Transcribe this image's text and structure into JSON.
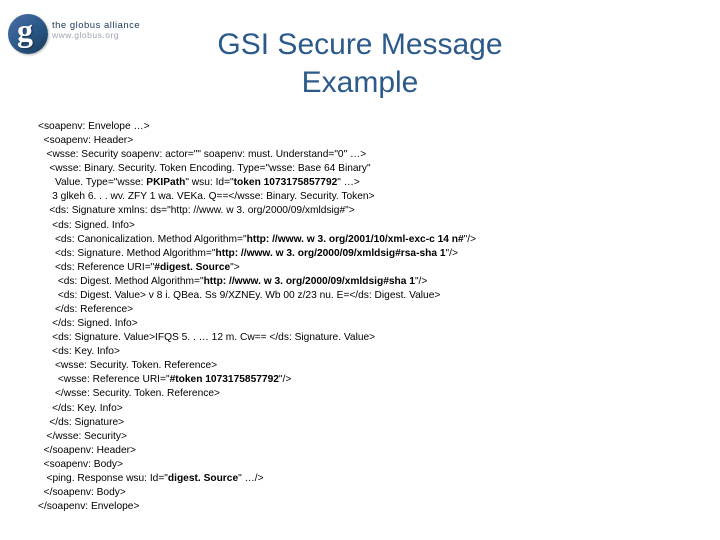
{
  "logo": {
    "main": "the globus alliance",
    "sub": "www.globus.org"
  },
  "title": "GSI Secure Message\nExample",
  "code": {
    "l01": "<soapenv: Envelope …>",
    "l02": "  <soapenv: Header>",
    "l03": "   <wsse: Security soapenv: actor=\"\" soapenv: must. Understand=\"0\" …>",
    "l04": "    <wsse: Binary. Security. Token Encoding. Type=\"wsse: Base 64 Binary\"",
    "l05a": "      Value. Type=\"wsse: ",
    "l05b": "PKIPath",
    "l05c": "\" wsu: Id=\"",
    "l05d": "token 1073175857792",
    "l05e": "\" …>",
    "l06": "     3 glkeh 6. . . wv. ZFY 1 wa. VEKa. Q==</wsse: Binary. Security. Token>",
    "l07": "    <ds: Signature xmlns: ds=\"http: //www. w 3. org/2000/09/xmldsig#\">",
    "l08": "     <ds: Signed. Info>",
    "l09a": "      <ds: Canonicalization. Method Algorithm=\"",
    "l09b": "http: //www. w 3. org/2001/10/xml-exc-c 14 n#",
    "l09c": "\"/>",
    "l10a": "      <ds: Signature. Method Algorithm=\"",
    "l10b": "http: //www. w 3. org/2000/09/xmldsig#rsa-sha 1",
    "l10c": "\"/>",
    "l11a": "      <ds: Reference URI=\"",
    "l11b": "#digest. Source",
    "l11c": "\">",
    "l12a": "       <ds: Digest. Method Algorithm=\"",
    "l12b": "http: //www. w 3. org/2000/09/xmldsig#sha 1",
    "l12c": "\"/>",
    "l13": "       <ds: Digest. Value> v 8 i. QBea. Ss 9/XZNEy. Wb 00 z/23 nu. E=</ds: Digest. Value>",
    "l14": "      </ds: Reference>",
    "l15": "     </ds: Signed. Info>",
    "l16": "     <ds: Signature. Value>IFQS 5. . … 12 m. Cw== </ds: Signature. Value>",
    "l17": "     <ds: Key. Info>",
    "l18": "      <wsse: Security. Token. Reference>",
    "l19a": "       <wsse: Reference URI=\"",
    "l19b": "#token 1073175857792",
    "l19c": "\"/>",
    "l20": "      </wsse: Security. Token. Reference>",
    "l21": "     </ds: Key. Info>",
    "l22": "    </ds: Signature>",
    "l23": "   </wsse: Security>",
    "l24": "  </soapenv: Header>",
    "l25": "  <soapenv: Body>",
    "l26a": "   <ping. Response wsu: Id=\"",
    "l26b": "digest. Source",
    "l26c": "\" …/>",
    "l27": "  </soapenv: Body>",
    "l28": "</soapenv: Envelope>"
  }
}
